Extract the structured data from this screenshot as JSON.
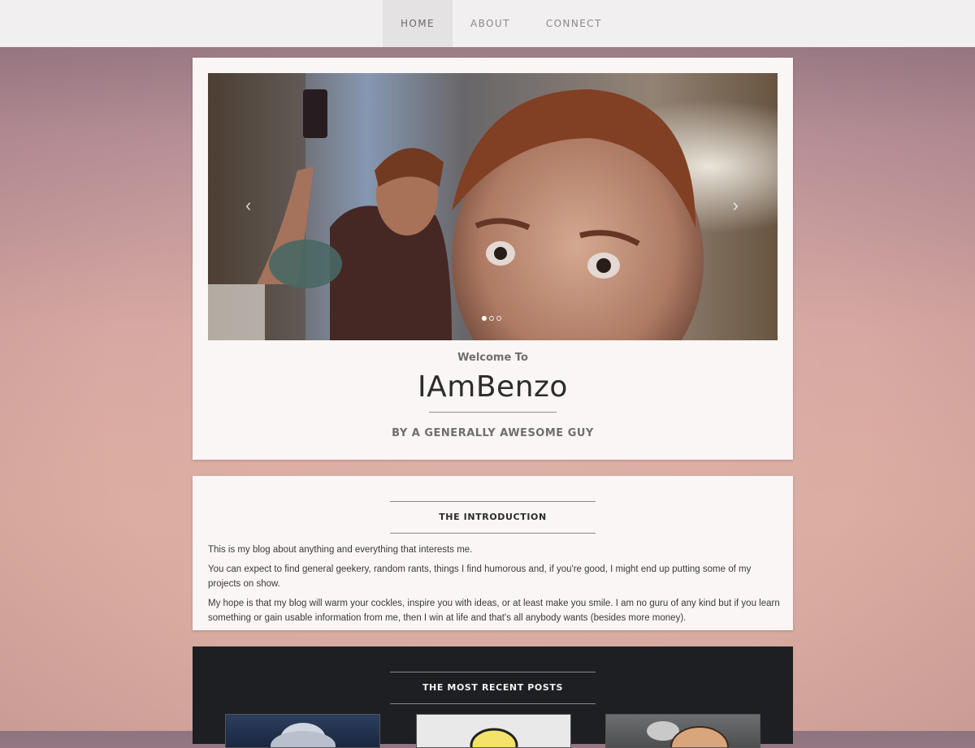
{
  "nav": {
    "items": [
      "HOME",
      "ABOUT",
      "CONNECT"
    ],
    "active": "HOME"
  },
  "carousel": {
    "prev": "‹",
    "next": "›",
    "slides": 3,
    "active_slide": 1
  },
  "hero": {
    "welcome": "Welcome To",
    "title": "IAmBenzo",
    "tagline": "BY A GENERALLY AWESOME GUY"
  },
  "intro": {
    "heading": "THE INTRODUCTION",
    "paragraphs": [
      "This is my blog about anything and everything that interests me.",
      "You can expect to find general geekery, random rants, things I find humorous and, if you're good, I might end up putting some of my projects on show.",
      "My hope is that my blog will warm your cockles, inspire you with ideas, or at least make you smile. I am no guru of any kind but if you learn something or gain usable information from me, then I win at life and that's all anybody wants (besides more money)."
    ]
  },
  "recent": {
    "heading": "THE MOST RECENT POSTS"
  },
  "colors": {
    "nav_bg": "#f1eff0",
    "card_bg": "#faf6f5",
    "posts_bg": "#1d1f22"
  }
}
